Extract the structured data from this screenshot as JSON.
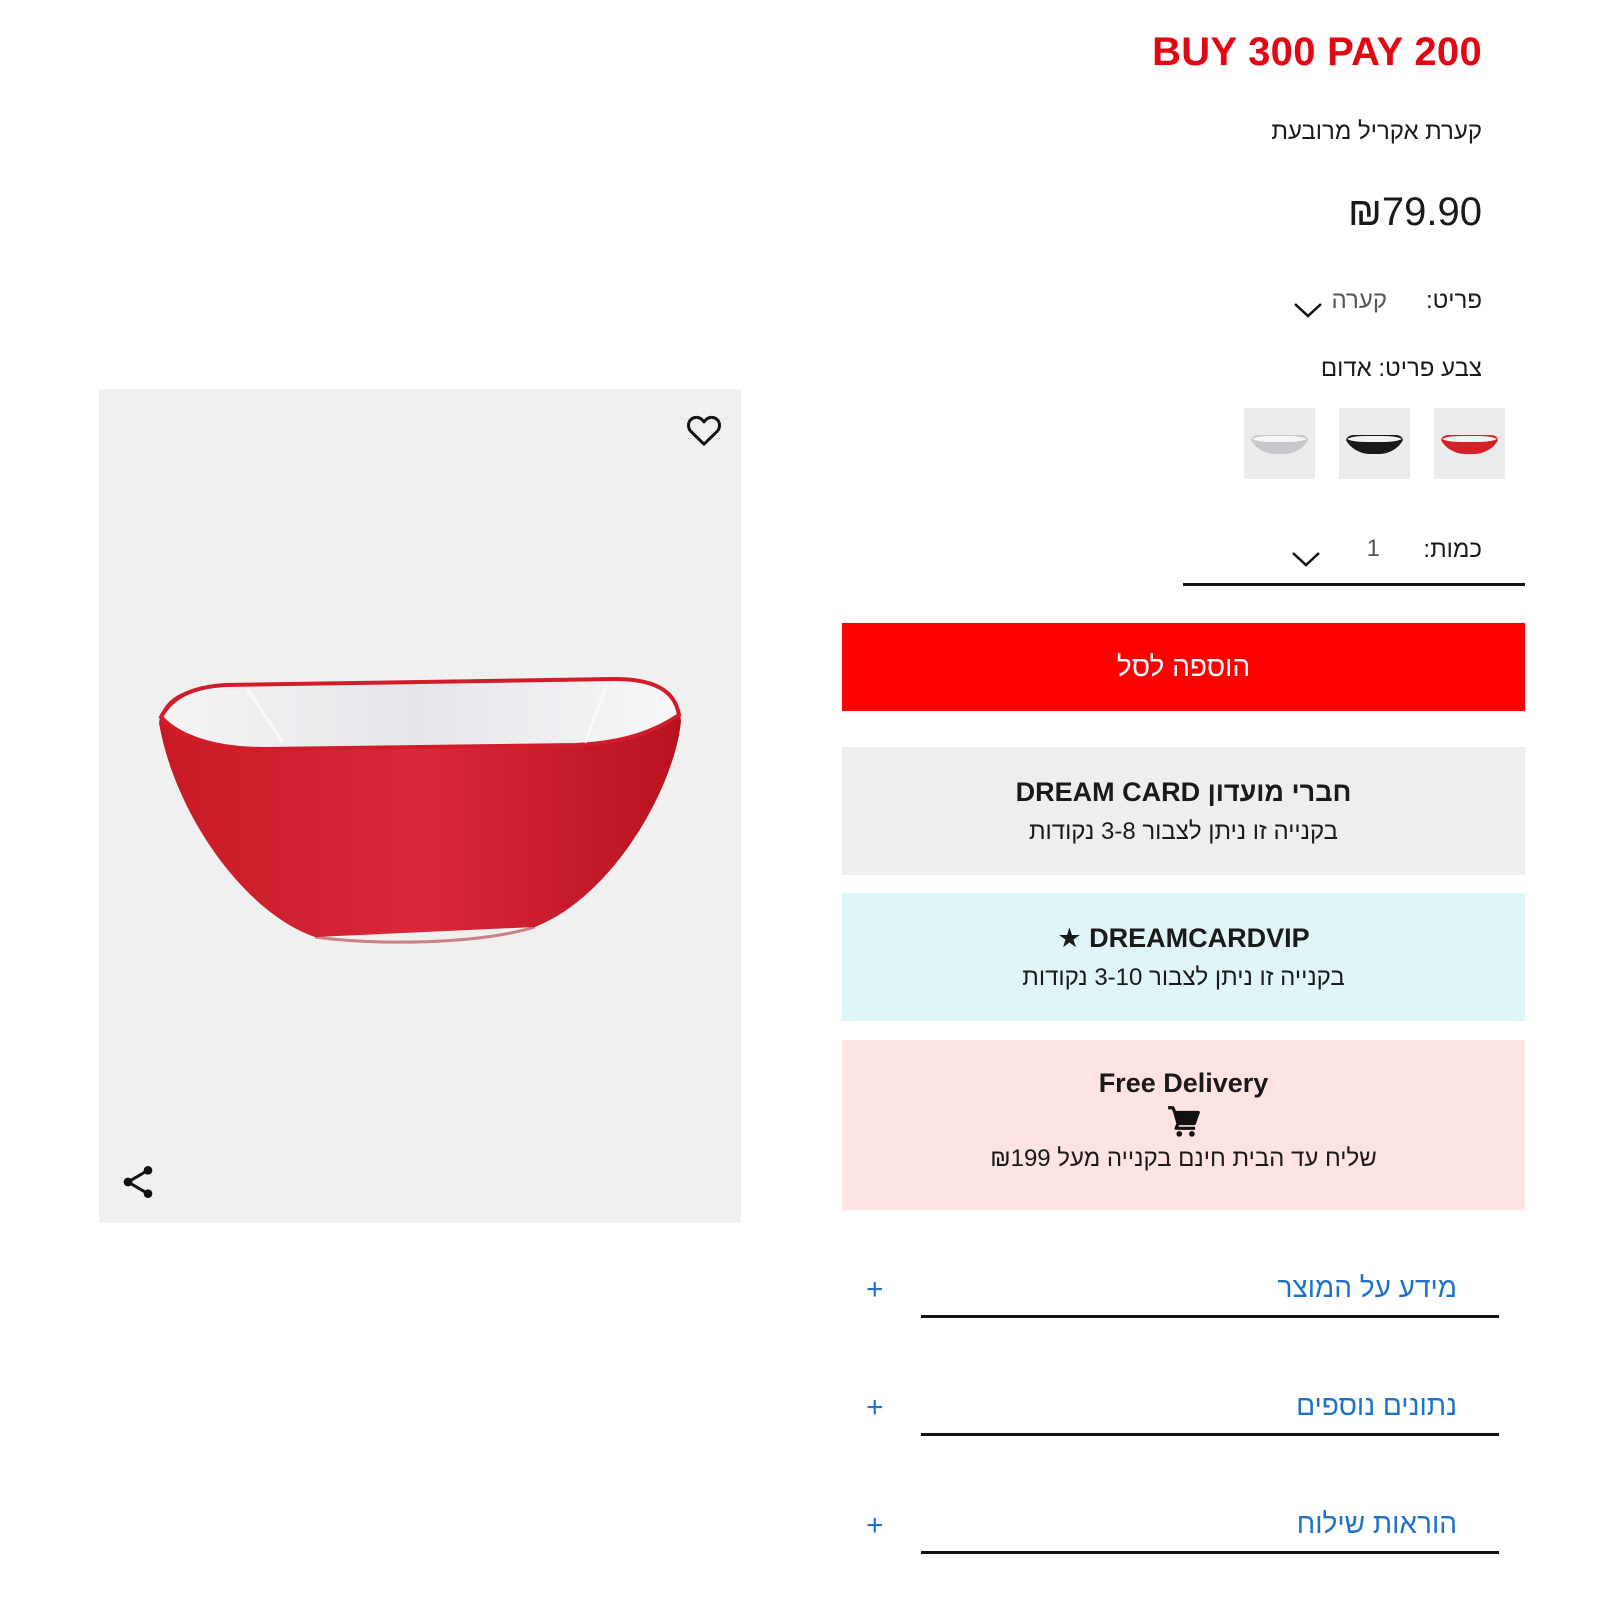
{
  "product": {
    "promo": "BUY 300 PAY 200",
    "name": "קערת אקריל מרובעת",
    "price": "₪79.90"
  },
  "options": {
    "item_label": "פריט:",
    "item_value": "קערה",
    "color_label": "צבע פריט: אדום",
    "swatches": [
      "אדום",
      "שחור",
      "לבן"
    ],
    "quantity_label": "כמות:",
    "quantity_value": "1"
  },
  "actions": {
    "add_to_cart": "הוספה לסל"
  },
  "cards": {
    "dream_card_title": "חברי מועדון DREAM CARD",
    "dream_card_text": "בקנייה זו ניתן לצבור 3-8 נקודות",
    "vip_title": "★ DREAMCARDVIP",
    "vip_text": "בקנייה זו ניתן לצבור 3-10 נקודות",
    "delivery_title": "Free Delivery",
    "delivery_text": "שליח עד הבית חינם בקנייה מעל ₪199"
  },
  "accordion": [
    {
      "label": "מידע על המוצר",
      "icon": "+"
    },
    {
      "label": "נתונים נוספים",
      "icon": "+"
    },
    {
      "label": "הוראות שילוח",
      "icon": "+"
    }
  ],
  "icons": {
    "wishlist": "heart-icon",
    "share": "share-icon",
    "dropdown": "chevron-down-icon",
    "cart": "cart-icon"
  },
  "colors": {
    "promo": "#e30613",
    "add_to_cart_bg": "#ff0000",
    "accordion_link": "#1e73c8",
    "dream_card_bg": "#eeeeee",
    "vip_bg": "#e0f5f8",
    "delivery_bg": "#fde3e1",
    "bowl_red": "#d71f2b"
  }
}
